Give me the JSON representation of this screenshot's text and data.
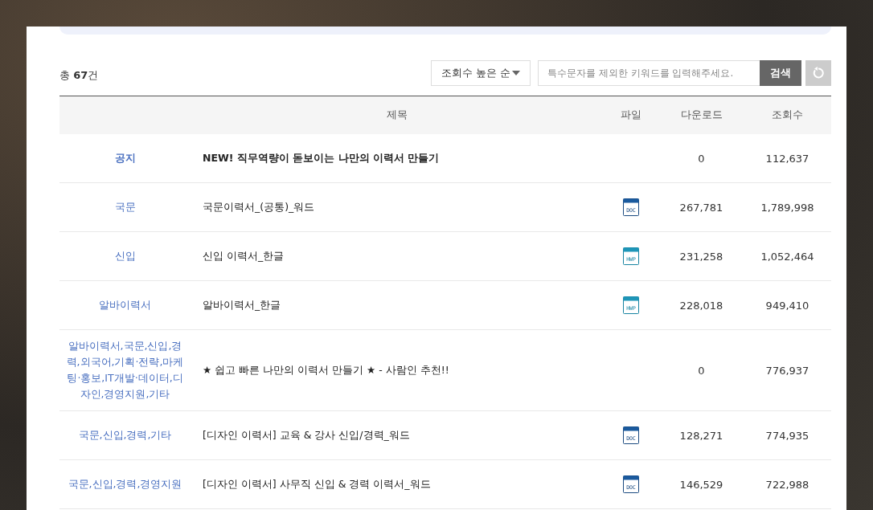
{
  "total": "총 **67**건",
  "sort": {
    "value": "조회수 높은 순"
  },
  "search": {
    "placeholder": "특수문자를 제외한 키워드를 입력해주세요.",
    "button": "검색"
  },
  "table": {
    "columns": [
      "제목",
      "파일",
      "다운로드",
      "조회수"
    ],
    "rows": [
      {
        "category": "공지",
        "title": "NEW! 직무역량이 돋보이는 나만의 이력서 만들기",
        "notice": true,
        "downloads": "0",
        "views": "112,637"
      },
      {
        "category": "국문",
        "title": "국문이력서_(공통)_워드",
        "notice": false,
        "file": {
          "kind": "doc",
          "label": "DOC"
        },
        "downloads": "267,781",
        "views": "1,789,998"
      },
      {
        "category": "신입",
        "title": "신입 이력서_한글",
        "notice": false,
        "file": {
          "kind": "hwp",
          "label": "HWP"
        },
        "downloads": "231,258",
        "views": "1,052,464"
      },
      {
        "category": "알바이력서",
        "title": "알바이력서_한글",
        "notice": false,
        "file": {
          "kind": "hwp",
          "label": "HWP"
        },
        "downloads": "228,018",
        "views": "949,410"
      },
      {
        "category": "알바이력서,국문,신입,경력,외국어,기획·전략,마케팅·홍보,IT개발·데이터,디자인,경영지원,기타",
        "title": "★ 쉽고 빠른 나만의 이력서 만들기 ★ - 사람인 추천!!",
        "notice": false,
        "downloads": "0",
        "views": "776,937"
      },
      {
        "category": "국문,신입,경력,기타",
        "title": "[디자인 이력서] 교육 & 강사 신입/경력_워드",
        "notice": false,
        "file": {
          "kind": "doc",
          "label": "DOC"
        },
        "downloads": "128,271",
        "views": "774,935"
      },
      {
        "category": "국문,신입,경력,경영지원",
        "title": "[디자인 이력서] 사무직 신입 & 경력 이력서_워드",
        "notice": false,
        "file": {
          "kind": "doc",
          "label": "DOC"
        },
        "downloads": "146,529",
        "views": "722,988"
      }
    ]
  }
}
